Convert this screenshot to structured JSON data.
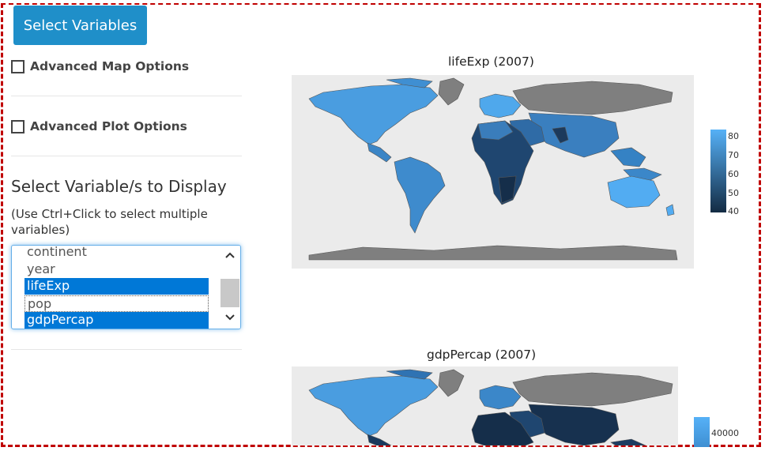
{
  "toolbar": {
    "select_variables_label": "Select Variables"
  },
  "options": {
    "advanced_map_label": "Advanced Map Options",
    "advanced_plot_label": "Advanced Plot Options",
    "advanced_map_checked": false,
    "advanced_plot_checked": false
  },
  "variable_select": {
    "title": "Select Variable/s to Display",
    "help": "(Use Ctrl+Click to select multiple variables)",
    "options": [
      {
        "label": "continent",
        "selected": false
      },
      {
        "label": "year",
        "selected": false
      },
      {
        "label": "lifeExp",
        "selected": true
      },
      {
        "label": "pop",
        "selected": false
      },
      {
        "label": "gdpPercap",
        "selected": true
      }
    ]
  },
  "maps": [
    {
      "title": "lifeExp (2007)",
      "legend_ticks": [
        "80",
        "70",
        "60",
        "50",
        "40"
      ],
      "legend_colors": [
        "#56b1f7",
        "#132b43"
      ]
    },
    {
      "title": "gdpPercap (2007)",
      "legend_ticks": [
        "40000"
      ],
      "legend_colors": [
        "#56b1f7",
        "#132b43"
      ]
    }
  ],
  "colors": {
    "accent": "#1f8fc9",
    "frame": "#c00000",
    "selection": "#0078d7",
    "map_background": "#ebebeb",
    "no_data": "#7f7f7f"
  }
}
